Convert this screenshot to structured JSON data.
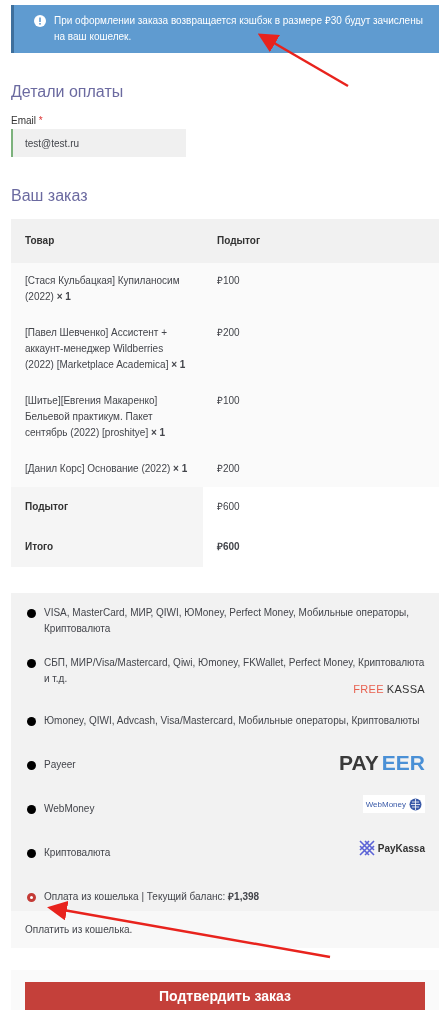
{
  "notice": {
    "text": "При оформлении заказа возвращается кэшбэк в размере ₽30 будут зачислены на ваш кошелек."
  },
  "billing": {
    "title": "Детали оплаты",
    "email": {
      "label": "Email",
      "required_mark": "*",
      "value": "test@test.ru"
    }
  },
  "order": {
    "title": "Ваш заказ",
    "columns": [
      "Товар",
      "Подытог"
    ],
    "rows": [
      {
        "product": "[Стася Кульбацкая] Купиланосим (2022) **× 1**",
        "subtotal": "₽100"
      },
      {
        "product": "[Павел Шевченко] Ассистент + аккаунт-менеджер Wildberries (2022) [Marketplace Academica] **× 1**",
        "subtotal": "₽200"
      },
      {
        "product": "[Шитье][Евгения Макаренко] Бельевой практикум. Пакет сентябрь (2022) [proshitye] **× 1**",
        "subtotal": "₽100"
      },
      {
        "product": "[Данил Корс] Основание (2022) **× 1**",
        "subtotal": "₽200"
      }
    ],
    "totals": [
      {
        "label": "Подытог",
        "value": "₽600",
        "bold": false
      },
      {
        "label": "Итого",
        "value": "₽600",
        "bold": true
      }
    ]
  },
  "payment_methods": [
    {
      "label": "VISA, MasterCard, МИР, QIWI, ЮMoney, Perfect Money, Мобильные операторы, Криптовалюта",
      "selected": false
    },
    {
      "label": "СБП, МИР/Visa/Mastercard, Qiwi, Юmoney, FKWallet, Perfect Money, Криптовалюта и т.д.",
      "selected": false,
      "logo": {
        "kind": "freekassa",
        "parts": [
          "FREE",
          "KASSA"
        ]
      }
    },
    {
      "label": "Юmoney, QIWI, Advcash, Visa/Mastercard, Мобильные операторы, Криптовалюты",
      "selected": false
    },
    {
      "label": "Payeer",
      "selected": false,
      "logo": {
        "kind": "payeer",
        "parts": [
          "PAY",
          "EER"
        ]
      }
    },
    {
      "label": "WebMoney",
      "selected": false,
      "logo": {
        "kind": "webmoney",
        "parts": [
          "WebMoney"
        ]
      }
    },
    {
      "label": "Криптовалюта",
      "selected": false,
      "logo": {
        "kind": "paykassa",
        "parts": [
          "PayKassa"
        ]
      }
    },
    {
      "label": "Оплата из кошелька | Текущий баланс: **₽1,398**",
      "selected": true
    }
  ],
  "payment_description": "Оплатить из кошелька.",
  "submit_button": "Подтвердить заказ"
}
